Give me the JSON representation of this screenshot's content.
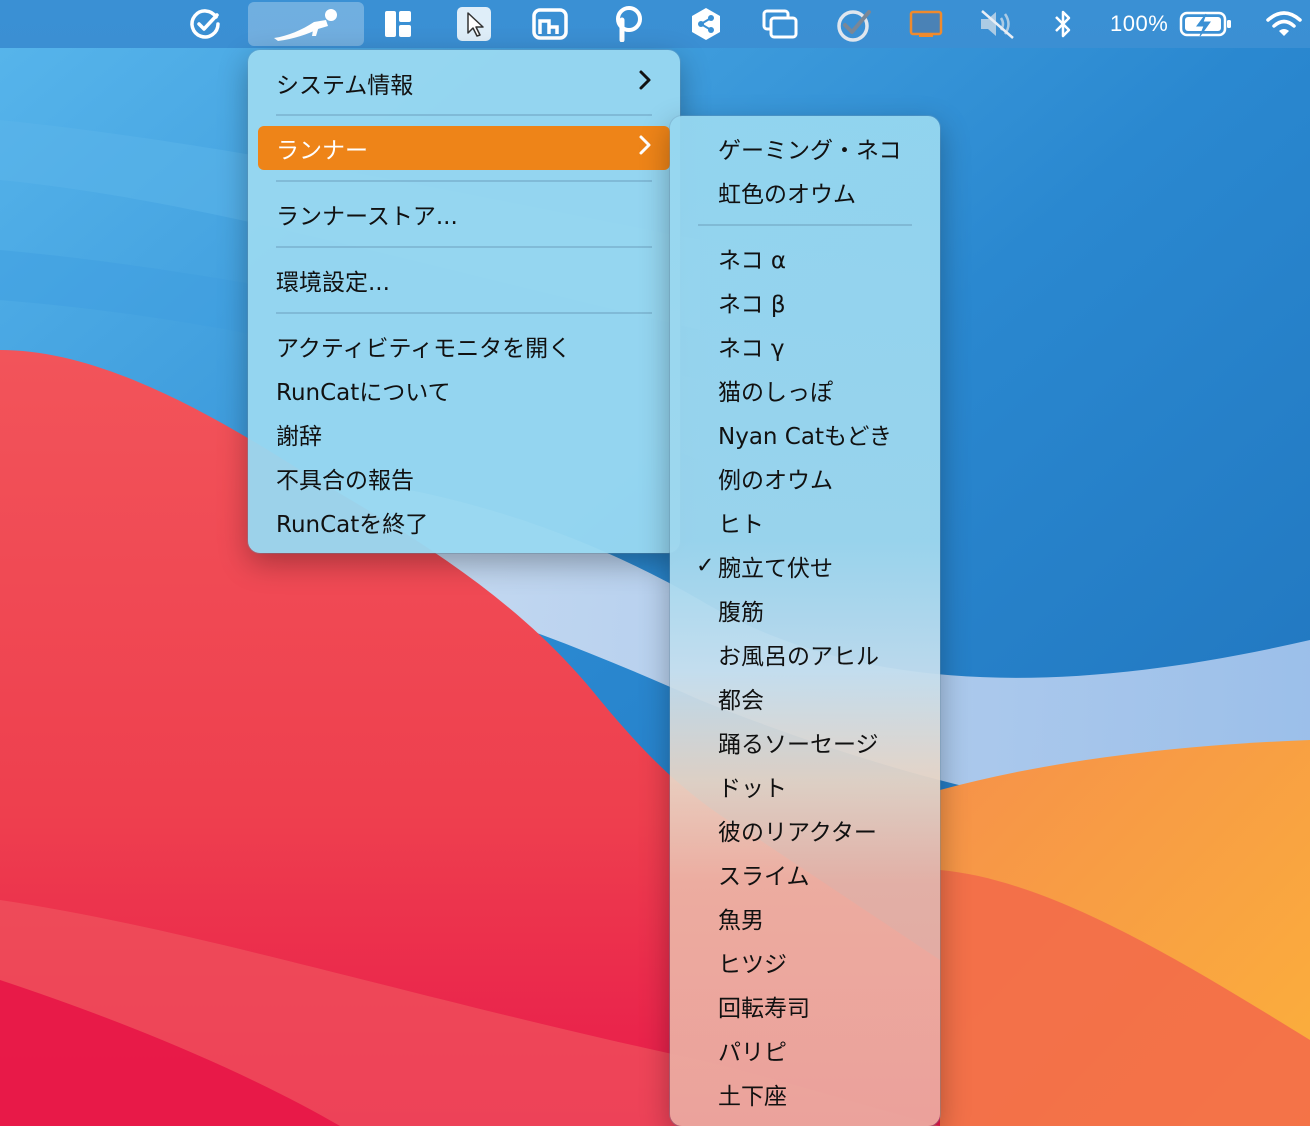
{
  "menubar": {
    "icons": [
      "checkmark-circle-icon",
      "runner-pushup-icon",
      "layout-grid-icon",
      "cursor-icon",
      "stats-graph-icon",
      "p-circle-icon",
      "share-hexagon-icon",
      "windows-icon",
      "check-badge-icon",
      "display-icon",
      "speaker-muted-icon",
      "bluetooth-icon",
      "battery-charging-icon",
      "wifi-icon"
    ],
    "battery_text": "100%"
  },
  "main_menu": {
    "items": [
      {
        "label": "システム情報",
        "submenu": true
      },
      {
        "label": "ランナー",
        "submenu": true,
        "highlighted": true
      },
      {
        "label": "ランナーストア..."
      },
      {
        "label": "環境設定..."
      },
      {
        "label": "アクティビティモニタを開く"
      },
      {
        "label": "RunCatについて"
      },
      {
        "label": "謝辞"
      },
      {
        "label": "不具合の報告"
      },
      {
        "label": "RunCatを終了"
      }
    ]
  },
  "runner_submenu": {
    "items": [
      {
        "label": "ゲーミング・ネコ"
      },
      {
        "label": "虹色のオウム"
      },
      {
        "label": "ネコ α"
      },
      {
        "label": "ネコ β"
      },
      {
        "label": "ネコ γ"
      },
      {
        "label": "猫のしっぽ"
      },
      {
        "label": "Nyan Catもどき"
      },
      {
        "label": "例のオウム"
      },
      {
        "label": "ヒト"
      },
      {
        "label": "腕立て伏せ",
        "checked": true
      },
      {
        "label": "腹筋"
      },
      {
        "label": "お風呂のアヒル"
      },
      {
        "label": "都会"
      },
      {
        "label": "踊るソーセージ"
      },
      {
        "label": "ドット"
      },
      {
        "label": "彼のリアクター"
      },
      {
        "label": "スライム"
      },
      {
        "label": "魚男"
      },
      {
        "label": "ヒツジ"
      },
      {
        "label": "回転寿司"
      },
      {
        "label": "パリピ"
      },
      {
        "label": "土下座"
      }
    ],
    "check_mark": "✓"
  },
  "colors": {
    "highlight": "#ee8418",
    "menu_bg": "#9ed7f0"
  }
}
